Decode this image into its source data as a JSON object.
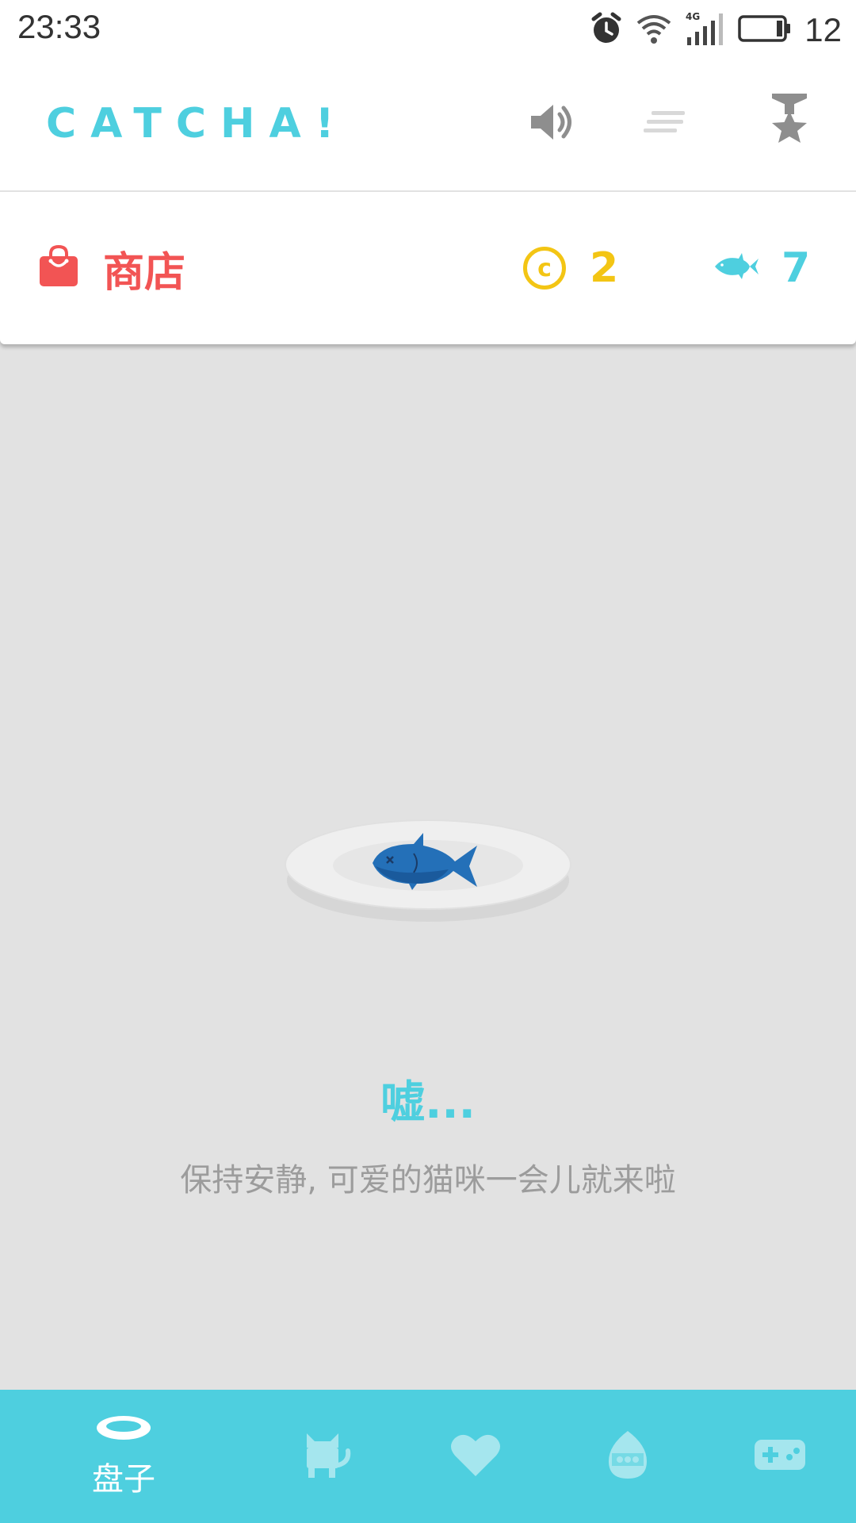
{
  "status_bar": {
    "time": "23:33",
    "battery": "12",
    "icons": [
      "alarm-icon",
      "wifi-icon",
      "signal-4g-icon",
      "battery-icon"
    ]
  },
  "header": {
    "title": "CATCHA!",
    "icons": [
      "speaker-icon",
      "menu-lines-icon",
      "medal-icon"
    ]
  },
  "store": {
    "label": "商店",
    "coins": "2",
    "fish": "7",
    "colors": {
      "store": "#f25454",
      "coin": "#f3c514",
      "fish": "#4ecfdf"
    }
  },
  "main": {
    "hint_title": "嘘...",
    "hint_text": "保持安静, 可爱的猫咪一会儿就来啦"
  },
  "bottom_nav": {
    "items": [
      {
        "label": "盘子",
        "icon": "plate-icon",
        "active": true
      },
      {
        "label": "",
        "icon": "cat-icon",
        "active": false
      },
      {
        "label": "",
        "icon": "heart-icon",
        "active": false
      },
      {
        "label": "",
        "icon": "egg-icon",
        "active": false
      },
      {
        "label": "",
        "icon": "gamepad-icon",
        "active": false
      }
    ]
  },
  "colors": {
    "accent": "#4ecfdf",
    "background": "#e2e2e2"
  }
}
